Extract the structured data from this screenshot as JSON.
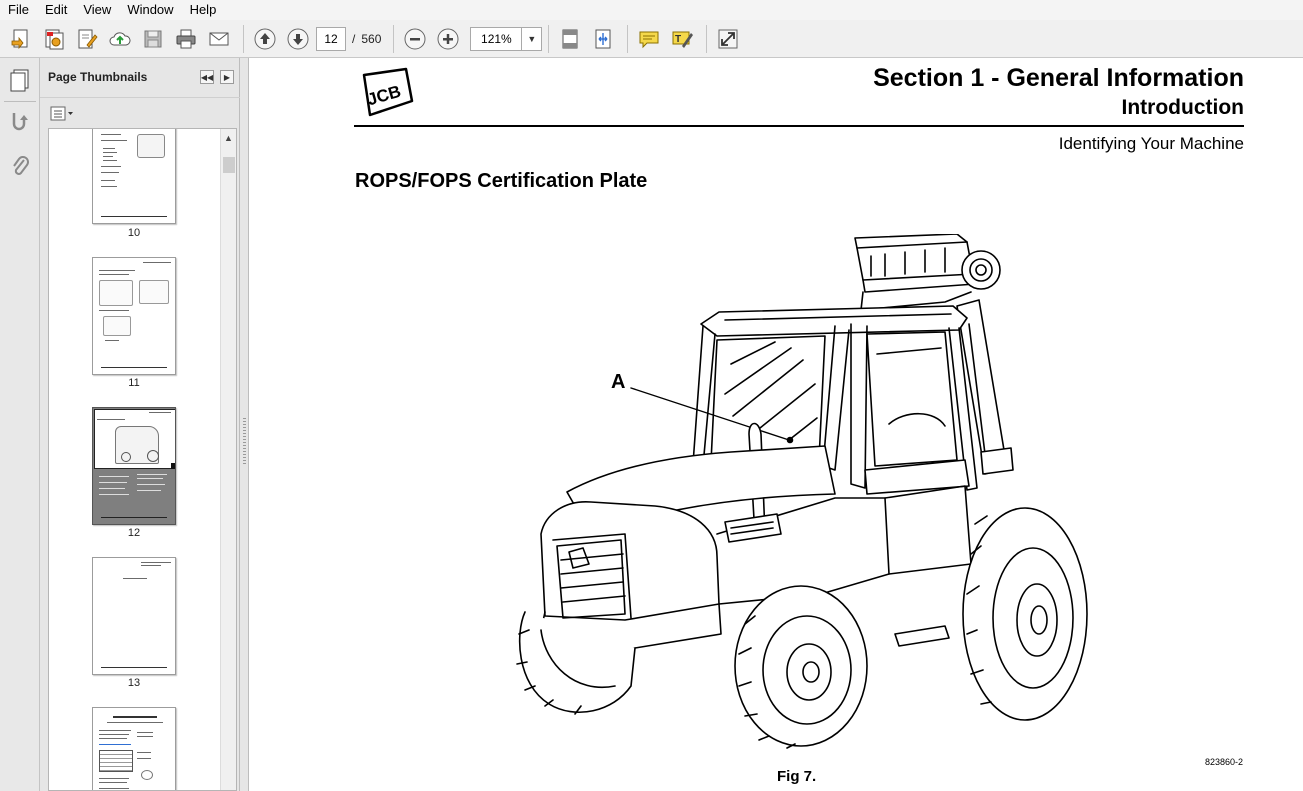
{
  "menu": [
    "File",
    "Edit",
    "View",
    "Window",
    "Help"
  ],
  "toolbar": {
    "page_current": "12",
    "page_separator": "/",
    "page_total": "560",
    "zoom": "121%",
    "icons": [
      "create-pdf-icon",
      "combine-files-icon",
      "edit-document-icon",
      "cloud-upload-icon",
      "save-icon",
      "print-icon",
      "email-icon",
      "previous-page-icon",
      "next-page-icon",
      "zoom-out-icon",
      "zoom-in-icon",
      "fit-page-icon",
      "fit-width-icon",
      "comment-icon",
      "highlight-icon",
      "full-screen-icon"
    ]
  },
  "sidebar": {
    "title": "Page Thumbnails",
    "thumbnails": [
      {
        "label": "10"
      },
      {
        "label": "11"
      },
      {
        "label": "12",
        "selected": true
      },
      {
        "label": "13"
      },
      {
        "label": ""
      }
    ]
  },
  "document": {
    "logo_text": "JCB",
    "section_title": "Section 1 - General Information",
    "subsection_title": "Introduction",
    "topic": "Identifying Your Machine",
    "heading": "ROPS/FOPS Certification Plate",
    "callout_label": "A",
    "figure_id": "823860-2",
    "figure_caption": "Fig 7."
  },
  "colors": {
    "toolbar_bg": "#f0f0f0",
    "panel_bg": "#e6e6e6",
    "selected_thumb": "#7f7f7f",
    "accent_blue": "#2f6fd3"
  }
}
